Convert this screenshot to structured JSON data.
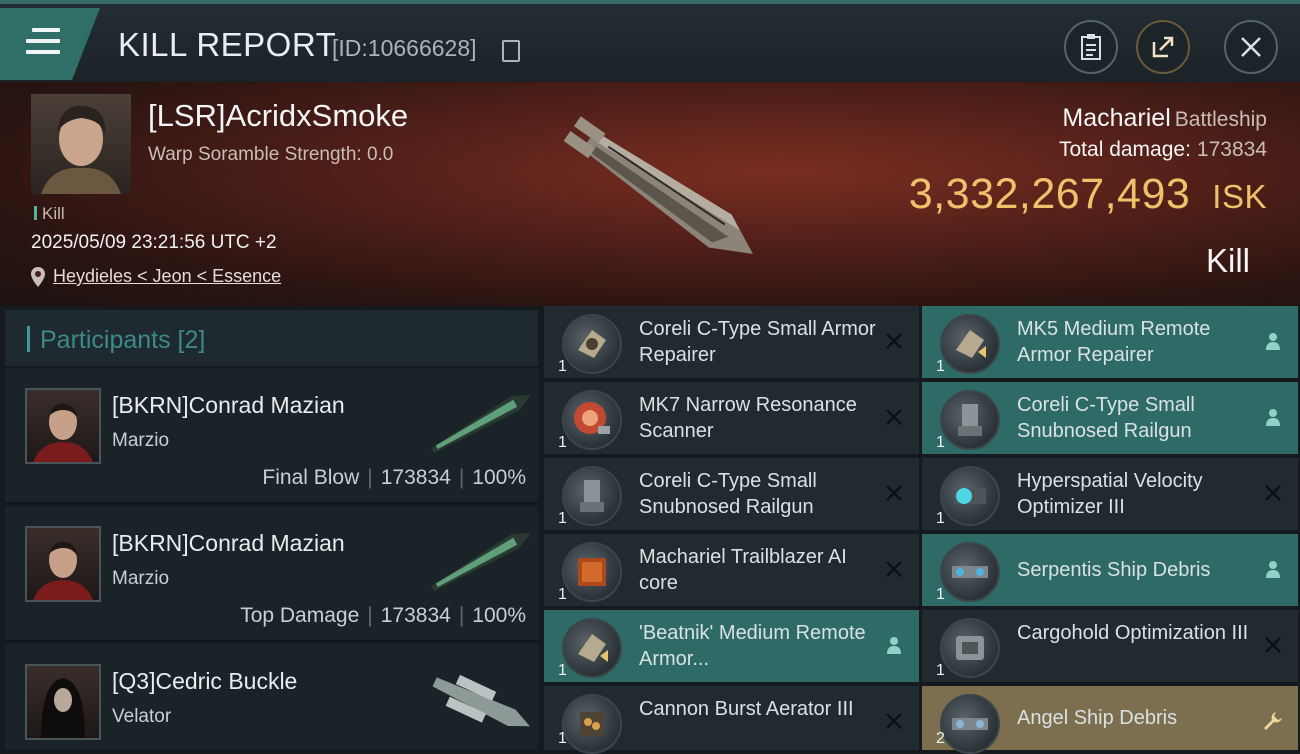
{
  "header": {
    "title": "KILL REPORT",
    "id_text": "[ID:10666628]"
  },
  "victim": {
    "name": "[LSR]AcridxSmoke",
    "scram": "Warp Soramble Strength: 0.0",
    "tag": "Kill",
    "datetime": "2025/05/09 23:21:56 UTC +2",
    "location": "Heydieles < Jeon < Essence",
    "ship_name": "Machariel",
    "ship_class": "Battleship",
    "total_damage_label": "Total damage:",
    "total_damage": "173834",
    "isk_value": "3,332,267,493",
    "isk_unit": "ISK",
    "result": "Kill"
  },
  "participants": {
    "title": "Participants [2]",
    "rows": [
      {
        "name": "[BKRN]Conrad Mazian",
        "ship": "Marzio",
        "role": "Final Blow",
        "damage": "173834",
        "pct": "100%"
      },
      {
        "name": "[BKRN]Conrad Mazian",
        "ship": "Marzio",
        "role": "Top Damage",
        "damage": "173834",
        "pct": "100%"
      },
      {
        "name": "[Q3]Cedric Buckle",
        "ship": "Velator",
        "role": "",
        "damage": "",
        "pct": ""
      }
    ]
  },
  "items_left": [
    {
      "name": "Coreli C-Type Small Armor Repairer",
      "qty": "1",
      "status": "destroyed"
    },
    {
      "name": "MK7 Narrow Resonance Scanner",
      "qty": "1",
      "status": "destroyed"
    },
    {
      "name": "Coreli C-Type Small Snubnosed Railgun",
      "qty": "1",
      "status": "destroyed"
    },
    {
      "name": "Machariel Trailblazer AI core",
      "qty": "1",
      "status": "destroyed"
    },
    {
      "name": "'Beatnik' Medium Remote Armor...",
      "qty": "1",
      "status": "dropped"
    },
    {
      "name": "Cannon Burst Aerator III",
      "qty": "1",
      "status": "destroyed"
    }
  ],
  "items_right": [
    {
      "name": "MK5 Medium Remote Armor Repairer",
      "qty": "1",
      "status": "dropped"
    },
    {
      "name": "Coreli C-Type Small Snubnosed Railgun",
      "qty": "1",
      "status": "dropped"
    },
    {
      "name": "Hyperspatial Velocity Optimizer III",
      "qty": "1",
      "status": "destroyed"
    },
    {
      "name": "Serpentis Ship Debris",
      "qty": "1",
      "status": "dropped"
    },
    {
      "name": "Cargohold Optimization III",
      "qty": "1",
      "status": "destroyed"
    },
    {
      "name": "Angel Ship Debris",
      "qty": "2",
      "status": "salvage"
    }
  ],
  "colors": {
    "accent_green": "#2e6b66",
    "isk_gold": "#f0c16b",
    "salvage_gold": "#7b6f4f"
  }
}
